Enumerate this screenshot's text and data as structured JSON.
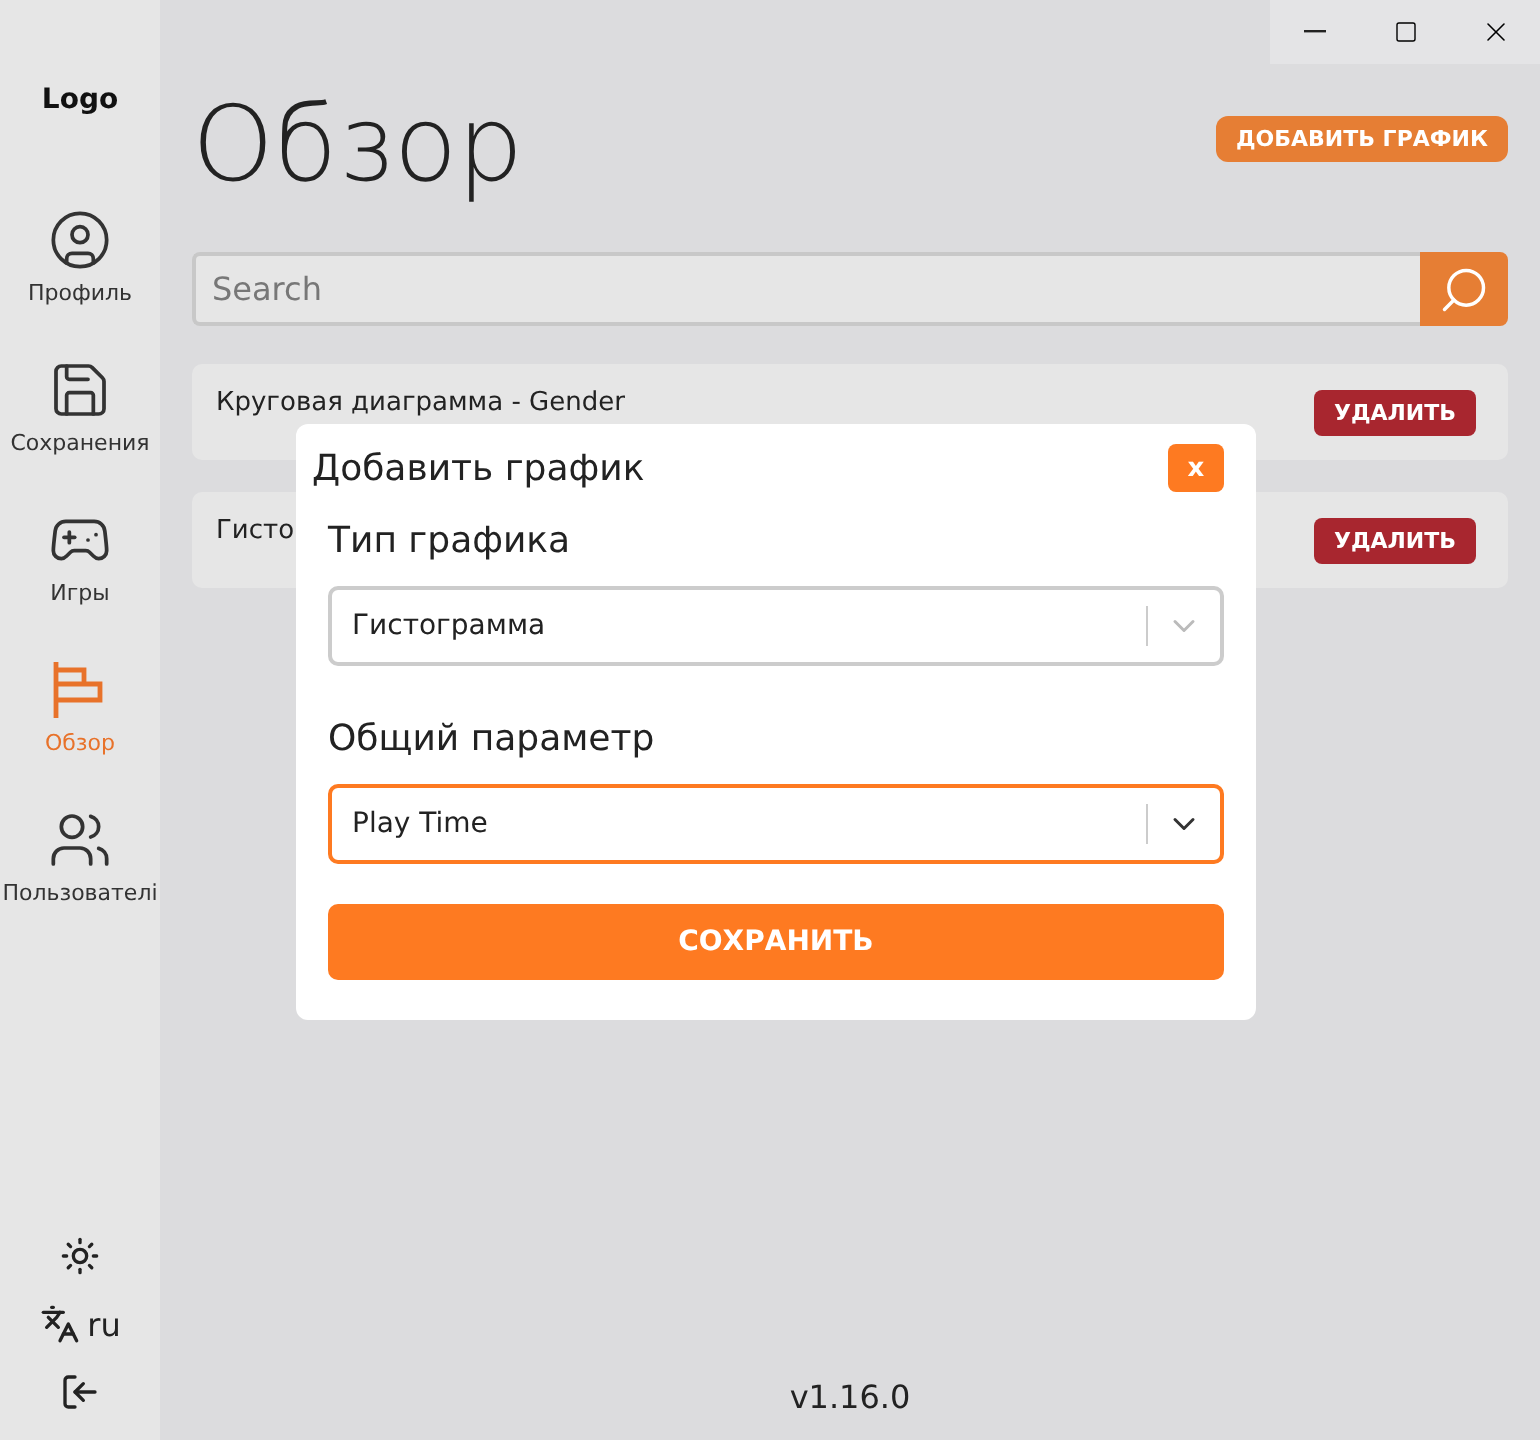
{
  "sidebar": {
    "logo": "Logo",
    "items": [
      {
        "kind": "profile",
        "label": "Профиль",
        "selected": false
      },
      {
        "kind": "save",
        "label": "Сохранения",
        "selected": false
      },
      {
        "kind": "games",
        "label": "Игры",
        "selected": false
      },
      {
        "kind": "overview",
        "label": "Обзор",
        "selected": true
      },
      {
        "kind": "users",
        "label": "Пользователі",
        "selected": false
      }
    ],
    "language": "ru"
  },
  "page": {
    "title": "Обзор",
    "add_button": "ДОБАВИТЬ ГРАФИК",
    "search": {
      "placeholder": "Search"
    },
    "charts": [
      {
        "name": "Круговая диаграмма - Gender",
        "delete": "УДАЛИТЬ"
      },
      {
        "name": "Гисто",
        "delete": "УДАЛИТЬ"
      }
    ],
    "version": "v1.16.0"
  },
  "dialog": {
    "title": "Добавить график",
    "close": "x",
    "fields": [
      {
        "label": "Тип графика",
        "value": "Гистограмма",
        "focused": false
      },
      {
        "label": "Общий параметр",
        "value": "Play Time",
        "focused": true
      }
    ],
    "save": "СОХРАНИТЬ"
  }
}
